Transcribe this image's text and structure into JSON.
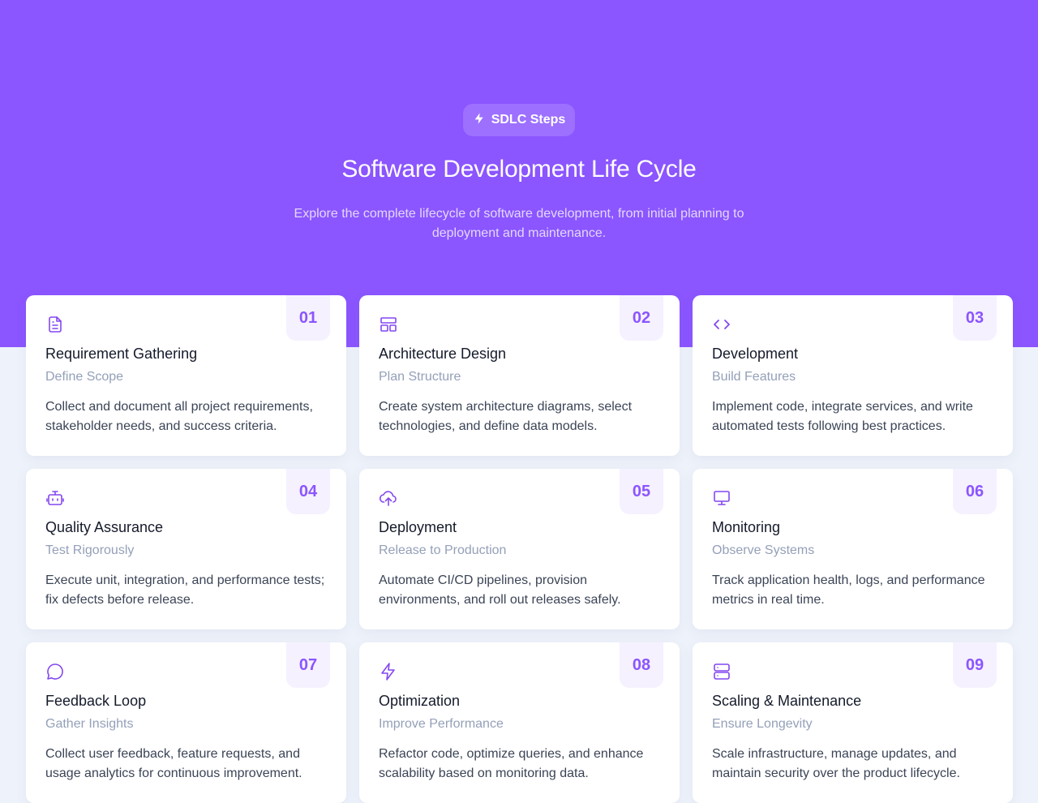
{
  "badge": {
    "label": "SDLC Steps",
    "icon": "bolt-icon"
  },
  "header": {
    "title": "Software Development Life Cycle",
    "subtitle": "Explore the complete lifecycle of software development, from initial planning to deployment and maintenance."
  },
  "colors": {
    "accent": "#8b55ff",
    "hero_bg": "#8b55ff",
    "page_bg": "#eef2fa"
  },
  "steps": [
    {
      "number": "01",
      "icon": "document-icon",
      "title": "Requirement Gathering",
      "subtitle": "Define Scope",
      "description": "Collect and document all project requirements, stakeholder needs, and success criteria."
    },
    {
      "number": "02",
      "icon": "layout-icon",
      "title": "Architecture Design",
      "subtitle": "Plan Structure",
      "description": "Create system architecture diagrams, select technologies, and define data models."
    },
    {
      "number": "03",
      "icon": "code-icon",
      "title": "Development",
      "subtitle": "Build Features",
      "description": "Implement code, integrate services, and write automated tests following best practices."
    },
    {
      "number": "04",
      "icon": "bot-icon",
      "title": "Quality Assurance",
      "subtitle": "Test Rigorously",
      "description": "Execute unit, integration, and performance tests; fix defects before release."
    },
    {
      "number": "05",
      "icon": "cloud-upload-icon",
      "title": "Deployment",
      "subtitle": "Release to Production",
      "description": "Automate CI/CD pipelines, provision environments, and roll out releases safely."
    },
    {
      "number": "06",
      "icon": "monitor-icon",
      "title": "Monitoring",
      "subtitle": "Observe Systems",
      "description": "Track application health, logs, and performance metrics in real time."
    },
    {
      "number": "07",
      "icon": "chat-icon",
      "title": "Feedback Loop",
      "subtitle": "Gather Insights",
      "description": "Collect user feedback, feature requests, and usage analytics for continuous improvement."
    },
    {
      "number": "08",
      "icon": "bolt-icon",
      "title": "Optimization",
      "subtitle": "Improve Performance",
      "description": "Refactor code, optimize queries, and enhance scalability based on monitoring data."
    },
    {
      "number": "09",
      "icon": "server-icon",
      "title": "Scaling & Maintenance",
      "subtitle": "Ensure Longevity",
      "description": "Scale infrastructure, manage updates, and maintain security over the product lifecycle."
    }
  ]
}
